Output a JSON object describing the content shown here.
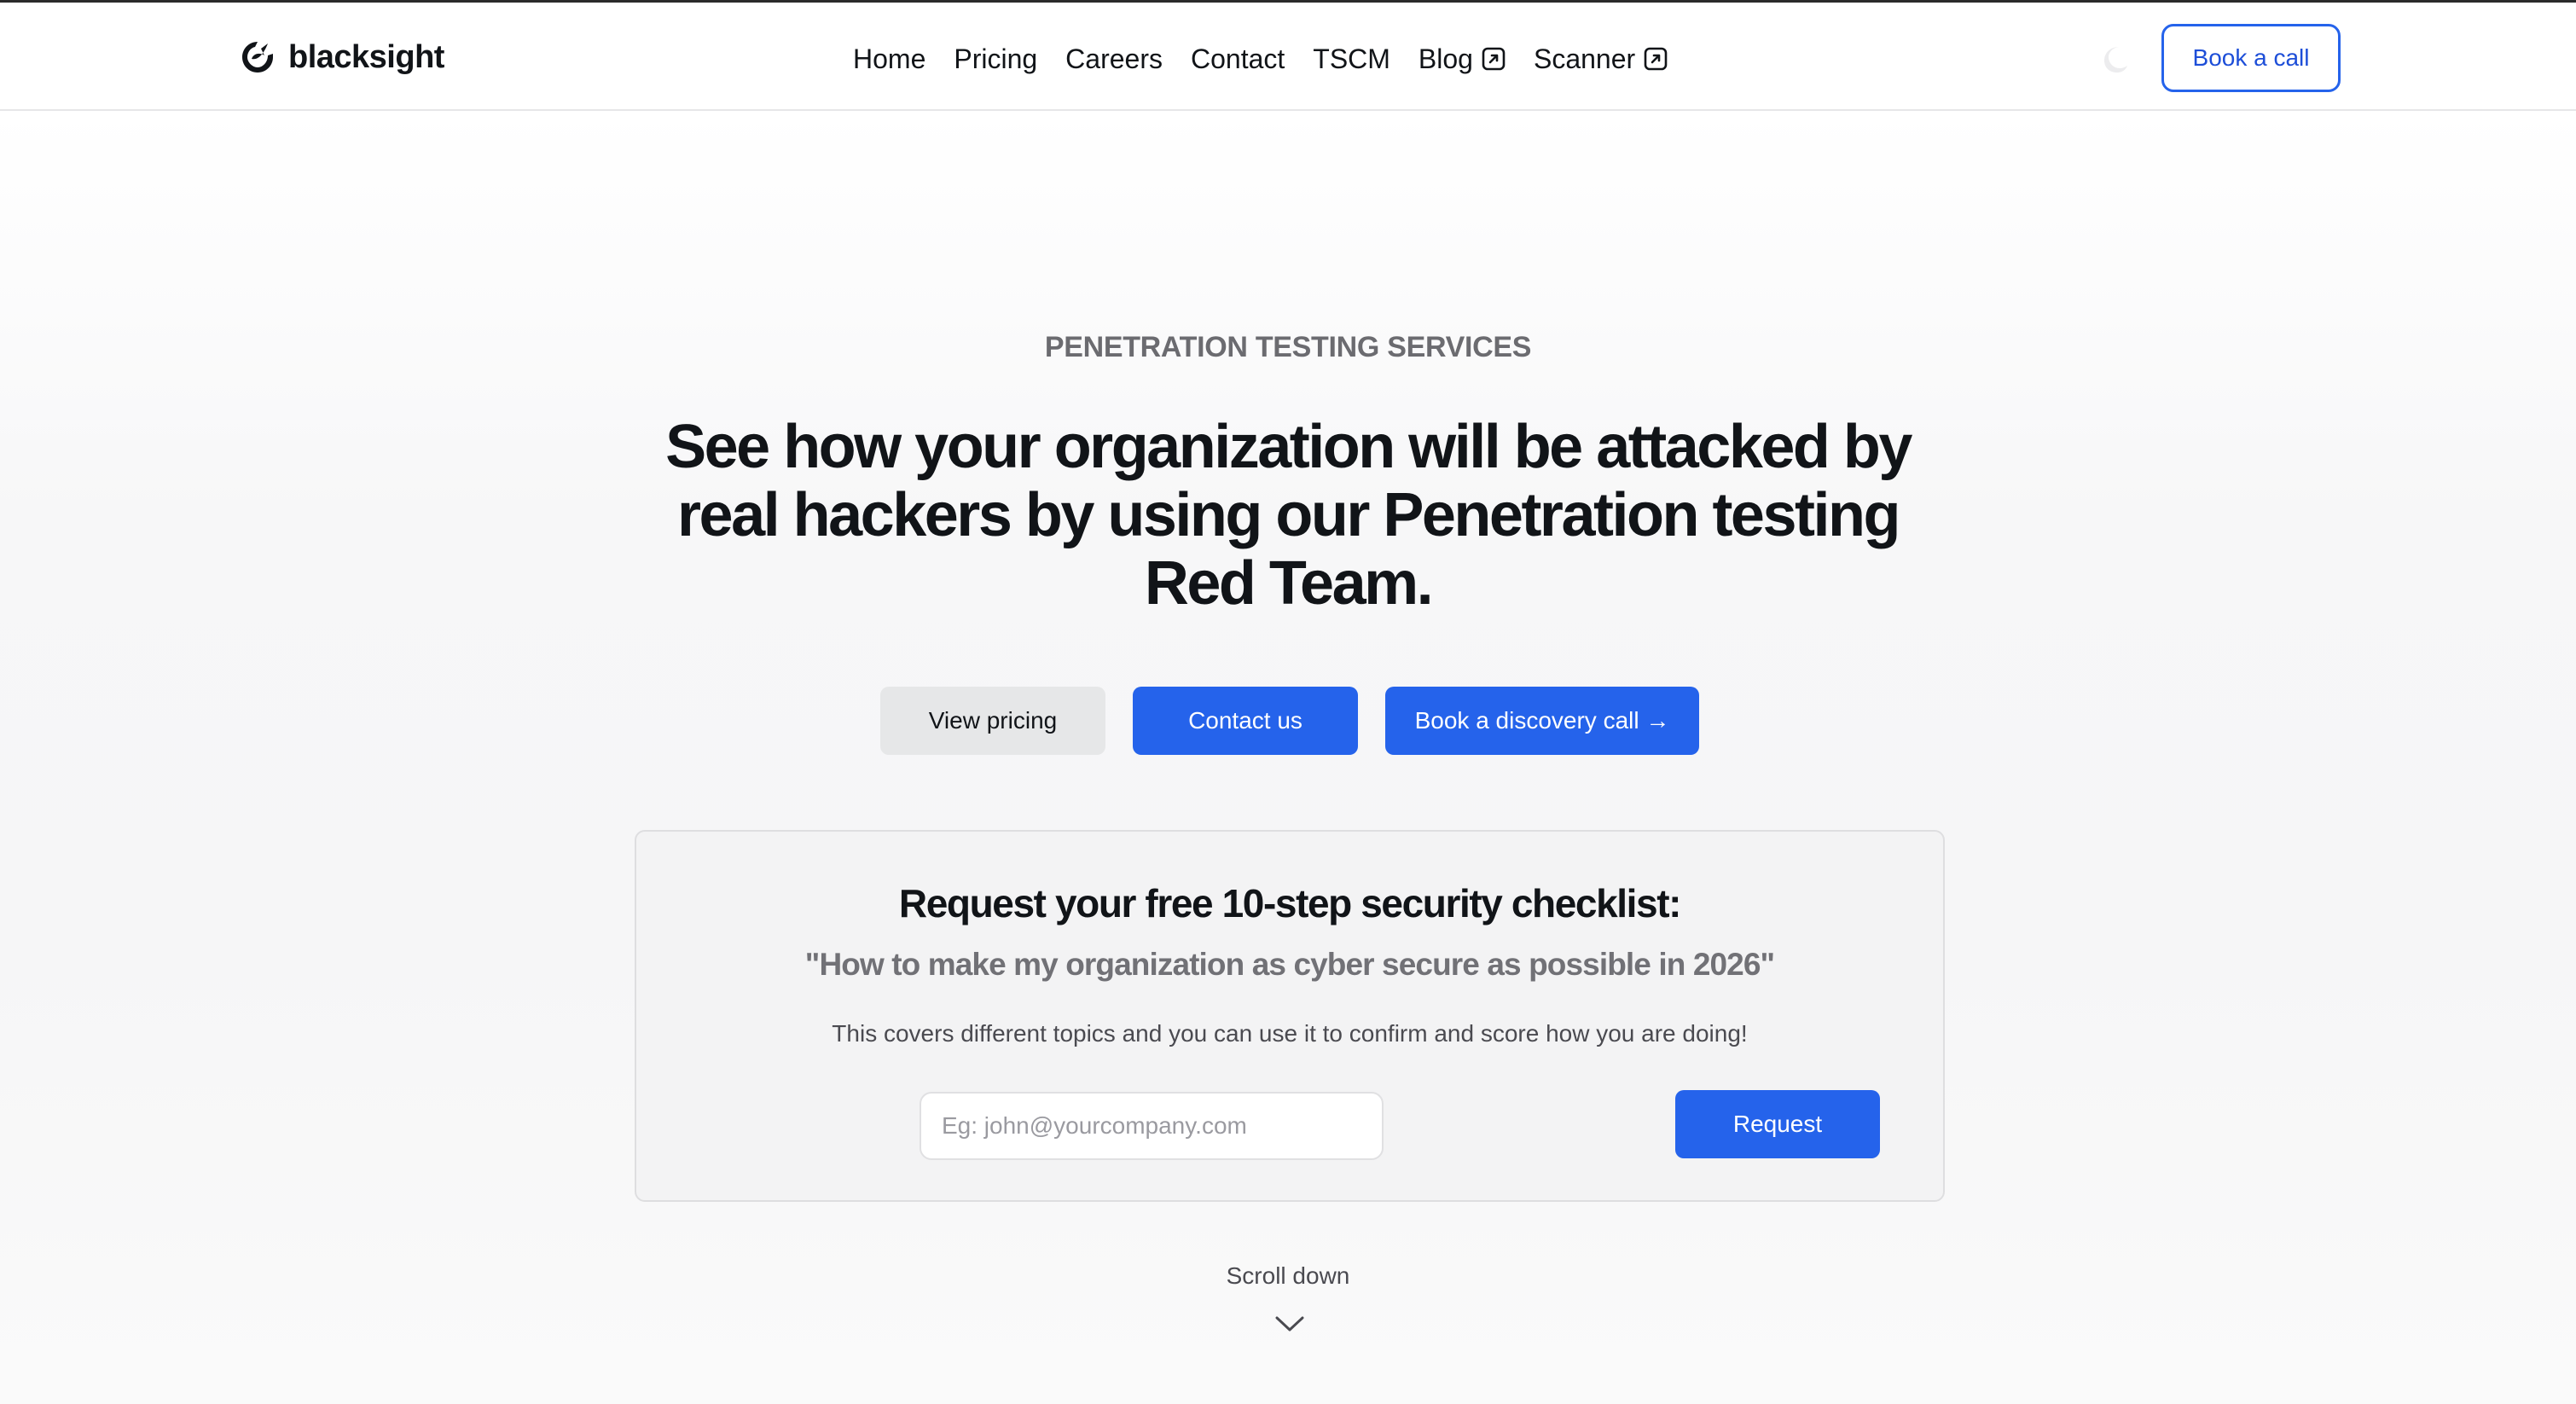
{
  "brand": {
    "name": "blacksight"
  },
  "nav": {
    "items": [
      {
        "label": "Home",
        "external": false
      },
      {
        "label": "Pricing",
        "external": false
      },
      {
        "label": "Careers",
        "external": false
      },
      {
        "label": "Contact",
        "external": false
      },
      {
        "label": "TSCM",
        "external": false
      },
      {
        "label": "Blog",
        "external": true,
        "icon": "external-link-icon"
      },
      {
        "label": "Scanner",
        "external": true,
        "icon": "external-link-icon"
      }
    ],
    "theme_toggle_icon": "moon-icon",
    "cta_label": "Book a call"
  },
  "hero": {
    "eyebrow": "PENETRATION TESTING SERVICES",
    "headline": "See how your organization will be attacked by real hackers by using our Penetration testing Red Team.",
    "buttons": {
      "view_pricing": "View pricing",
      "contact_us": "Contact us",
      "discovery_call": "Book a discovery call →"
    }
  },
  "checklist": {
    "title": "Request your free 10-step security checklist:",
    "quote": "\"How to make my organization as cyber secure as possible in 2026\"",
    "description": "This covers different topics and you can use it to confirm and score how you are doing!",
    "email_placeholder": "Eg: john@yourcompany.com",
    "email_value": "",
    "submit_label": "Request"
  },
  "scroll": {
    "label": "Scroll down",
    "icon": "chevron-down-icon"
  },
  "colors": {
    "accent": "#2563eb",
    "text": "#111418",
    "muted": "#6b6b70",
    "secondary_button": "#e6e7e8",
    "card_background": "#f3f3f4"
  }
}
